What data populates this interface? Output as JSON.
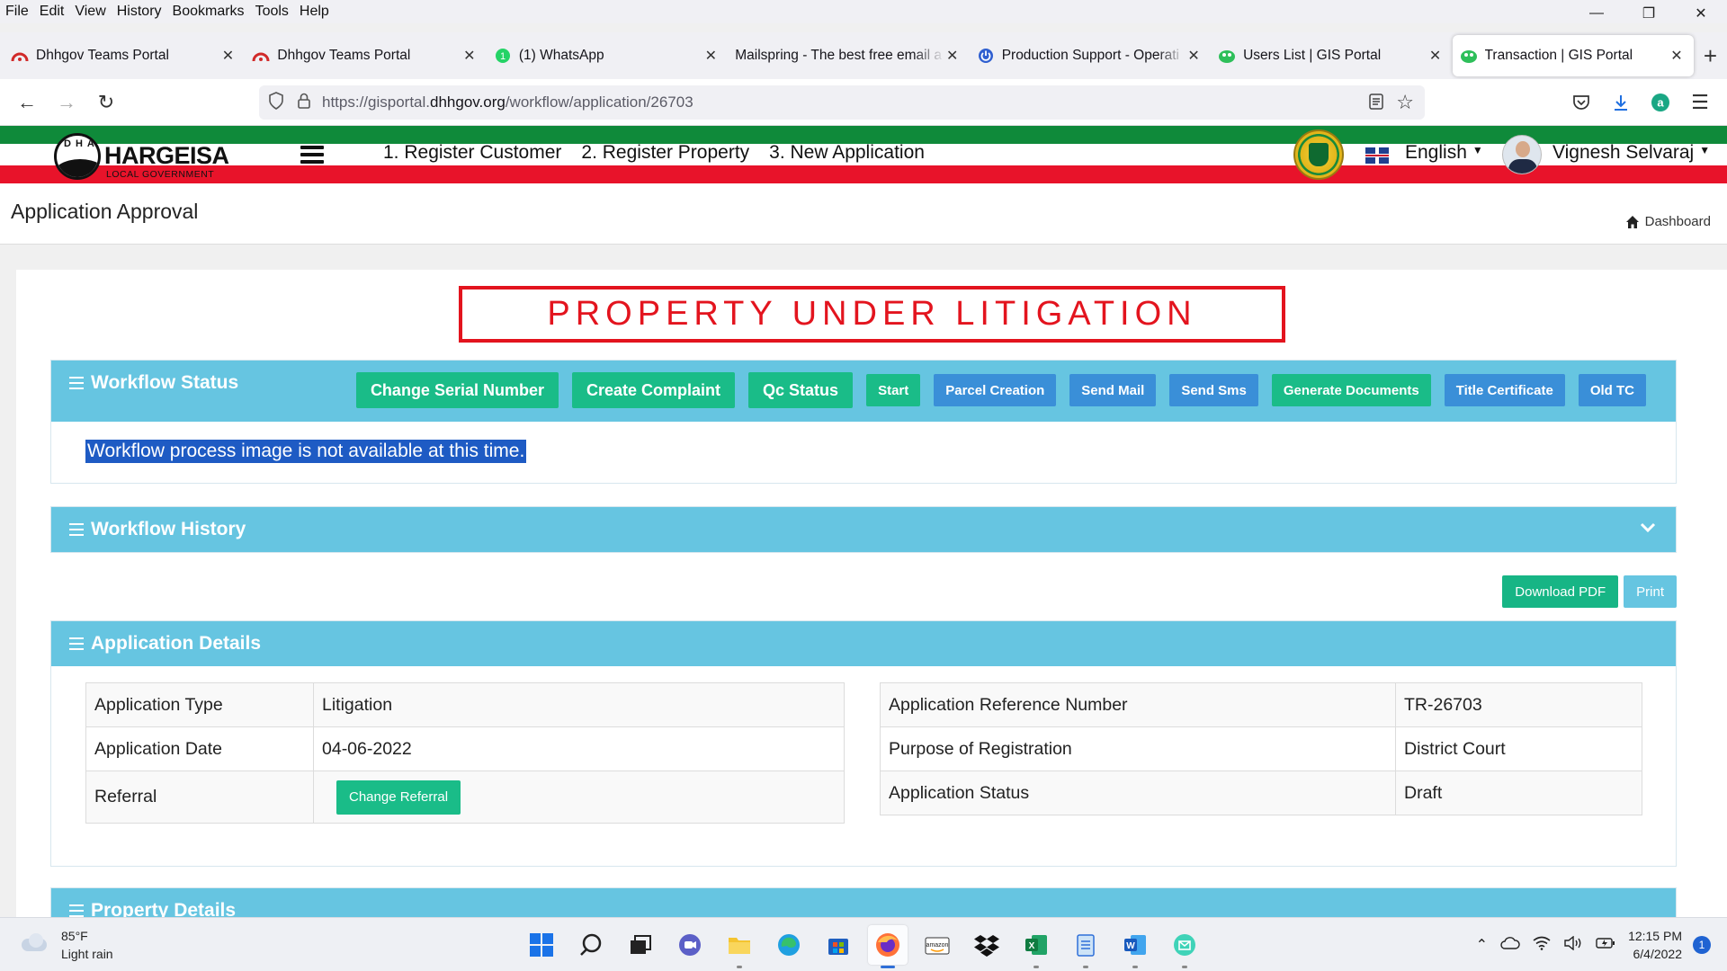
{
  "menubar": {
    "items": [
      "File",
      "Edit",
      "View",
      "History",
      "Bookmarks",
      "Tools",
      "Help"
    ]
  },
  "tabs": [
    {
      "title": "Dhhgov Teams Portal",
      "favicon": "teams-red-icon"
    },
    {
      "title": "Dhhgov Teams Portal",
      "favicon": "teams-red-icon"
    },
    {
      "title": "(1) WhatsApp",
      "favicon": "whatsapp-icon"
    },
    {
      "title": "Mailspring - The best free email a",
      "favicon": "none"
    },
    {
      "title": "Production Support - Operati",
      "favicon": "power-icon"
    },
    {
      "title": "Users List | GIS Portal",
      "favicon": "gis-globe-icon"
    },
    {
      "title": "Transaction | GIS Portal",
      "favicon": "gis-globe-icon",
      "active": true
    }
  ],
  "address": {
    "prefix": "https://gisportal.",
    "domain": "dhhgov.org",
    "path": "/workflow/application/26703"
  },
  "site": {
    "logo_letters": "DHA",
    "brand": "HARGEISA",
    "brand_sub": "LOCAL GOVERNMENT",
    "nav": [
      "1. Register Customer",
      "2. Register Property",
      "3. New Application"
    ],
    "language": "English",
    "user": "Vignesh Selvaraj"
  },
  "page": {
    "title": "Application Approval",
    "breadcrumb": "Dashboard"
  },
  "banner": "PROPERTY UNDER LITIGATION",
  "workflow_status": {
    "title": "Workflow Status",
    "buttons_big": [
      "Change Serial Number",
      "Create Complaint",
      "Qc Status"
    ],
    "buttons_small": [
      {
        "label": "Start",
        "color": "green"
      },
      {
        "label": "Parcel Creation",
        "color": "blue"
      },
      {
        "label": "Send Mail",
        "color": "blue"
      },
      {
        "label": "Send Sms",
        "color": "blue"
      },
      {
        "label": "Generate Documents",
        "color": "green"
      },
      {
        "label": "Title Certificate",
        "color": "blue"
      },
      {
        "label": "Old TC",
        "color": "blue"
      }
    ],
    "message": "Workflow process image is not available at this time."
  },
  "workflow_history": {
    "title": "Workflow History"
  },
  "actions": {
    "download_pdf": "Download PDF",
    "print": "Print"
  },
  "application_details": {
    "title": "Application Details",
    "left": [
      {
        "label": "Application Type",
        "value": "Litigation"
      },
      {
        "label": "Application Date",
        "value": "04-06-2022"
      },
      {
        "label": "Referral",
        "button": "Change Referral"
      }
    ],
    "right": [
      {
        "label": "Application Reference Number",
        "value": "TR-26703"
      },
      {
        "label": "Purpose of Registration",
        "value": "District Court"
      },
      {
        "label": "Application Status",
        "value": "Draft"
      }
    ]
  },
  "property_details": {
    "title": "Property Details"
  },
  "taskbar": {
    "temperature": "85°F",
    "weather": "Light rain",
    "time": "12:15 PM",
    "date": "6/4/2022",
    "notifications": "1"
  },
  "colors": {
    "panel_header": "#66c5e1",
    "button_green": "#1abc88",
    "button_blue": "#3a8fd8",
    "litigation_red": "#e3141e",
    "stripe_green": "#0f8a3a",
    "stripe_red": "#e8132a"
  }
}
